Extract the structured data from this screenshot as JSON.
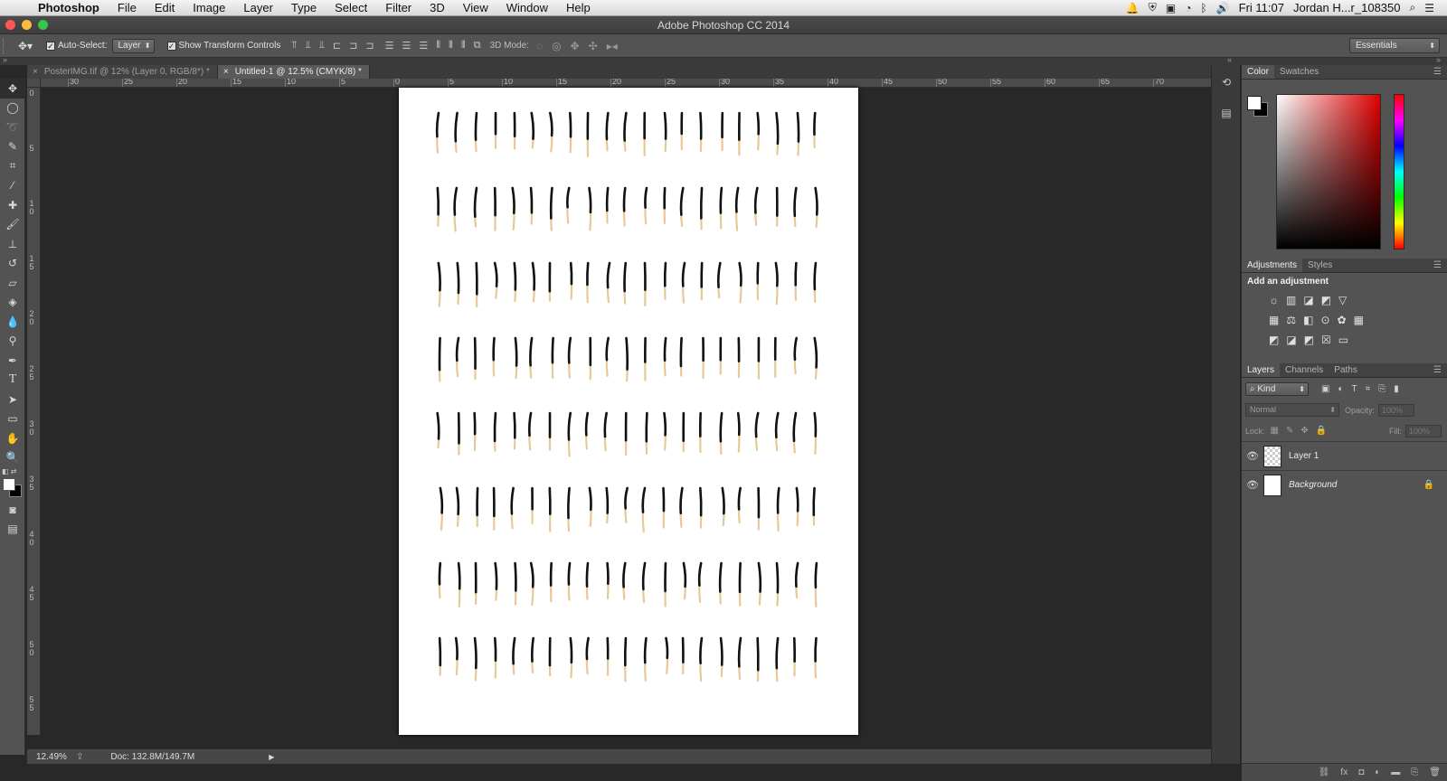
{
  "menubar": {
    "apple_glyph": "",
    "app_name": "Photoshop",
    "menus": [
      "File",
      "Edit",
      "Image",
      "Layer",
      "Type",
      "Select",
      "Filter",
      "3D",
      "View",
      "Window",
      "Help"
    ],
    "clock": "Fri 11:07",
    "user": "Jordan H...r_108350"
  },
  "window": {
    "title": "Adobe Photoshop CC 2014",
    "close_color": "#fc5753",
    "minimize_color": "#fdbc40",
    "zoom_color": "#33c748"
  },
  "options": {
    "auto_select_label": "Auto-Select:",
    "auto_select_value": "Layer",
    "show_transform_label": "Show Transform Controls",
    "mode3d_label": "3D Mode:",
    "workspace": "Essentials"
  },
  "tabs": [
    {
      "label": "PosterIMG.tif @ 12% (Layer 0, RGB/8*) *",
      "close": "×"
    },
    {
      "label": "Untitled-1 @ 12.5% (CMYK/8) *",
      "close": "×"
    }
  ],
  "ruler": {
    "top_labels": [
      "30",
      "25",
      "20",
      "15",
      "10",
      "5",
      "0",
      "5",
      "10",
      "15",
      "20",
      "25",
      "30",
      "35",
      "40",
      "45",
      "50",
      "55",
      "60",
      "65",
      "70"
    ],
    "left_labels": [
      "0",
      "5",
      "1 0",
      "1 5",
      "2 0",
      "2 5",
      "3 0",
      "3 5",
      "4 0",
      "4 5",
      "5 0",
      "5 5"
    ]
  },
  "status": {
    "zoom": "12.49%",
    "doc": "Doc: 132.8M/149.7M"
  },
  "panels": {
    "color_tabs": [
      "Color",
      "Swatches"
    ],
    "adjust_tabs": [
      "Adjustments",
      "Styles"
    ],
    "adjust_title": "Add an adjustment",
    "layers_tabs": [
      "Layers",
      "Channels",
      "Paths"
    ],
    "kind_filter": "Kind",
    "blend_mode": "Normal",
    "opacity_label": "Opacity:",
    "opacity_value": "100%",
    "lock_label": "Lock:",
    "fill_label": "Fill:",
    "fill_value": "100%",
    "layers": [
      {
        "name": "Layer 1",
        "thumb": "transparent"
      },
      {
        "name": "Background",
        "thumb": "white",
        "locked": true
      }
    ]
  },
  "artwork": {
    "rows": 8,
    "matches_per_row": 21,
    "stick_color": "#e8c896",
    "head_color": "#111111"
  }
}
